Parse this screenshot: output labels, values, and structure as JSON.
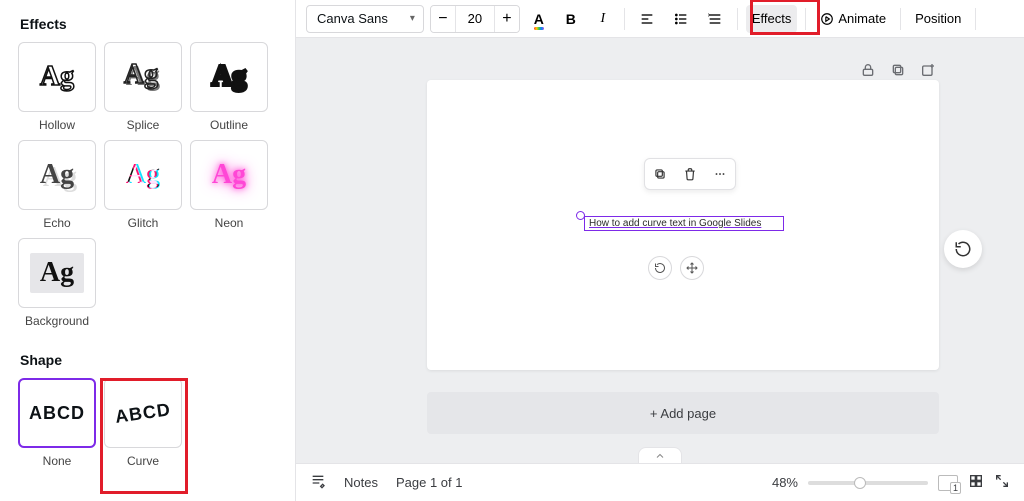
{
  "sidebar": {
    "effects_title": "Effects",
    "effects": [
      {
        "label": "Hollow",
        "variant": "hollow"
      },
      {
        "label": "Splice",
        "variant": "splice"
      },
      {
        "label": "Outline",
        "variant": "outline"
      },
      {
        "label": "Echo",
        "variant": "echo"
      },
      {
        "label": "Glitch",
        "variant": "glitch"
      },
      {
        "label": "Neon",
        "variant": "neon"
      },
      {
        "label": "Background",
        "variant": "bg"
      }
    ],
    "shape_title": "Shape",
    "shapes": [
      {
        "label": "None",
        "selected": true
      },
      {
        "label": "Curve",
        "selected": false
      }
    ],
    "sample_text": "ABCD"
  },
  "toolbar": {
    "font_name": "Canva Sans",
    "font_size": "20",
    "minus": "−",
    "plus": "+",
    "text_color_glyph": "A",
    "bold_glyph": "B",
    "italic_glyph": "I",
    "effects_label": "Effects",
    "animate_label": "Animate",
    "position_label": "Position"
  },
  "canvas": {
    "selected_text": "How to add curve text in Google Slides",
    "add_page_label": "+ Add page"
  },
  "bottombar": {
    "notes_label": "Notes",
    "page_indicator": "Page 1 of 1",
    "zoom_label": "48%",
    "zoom_percent": 48
  }
}
